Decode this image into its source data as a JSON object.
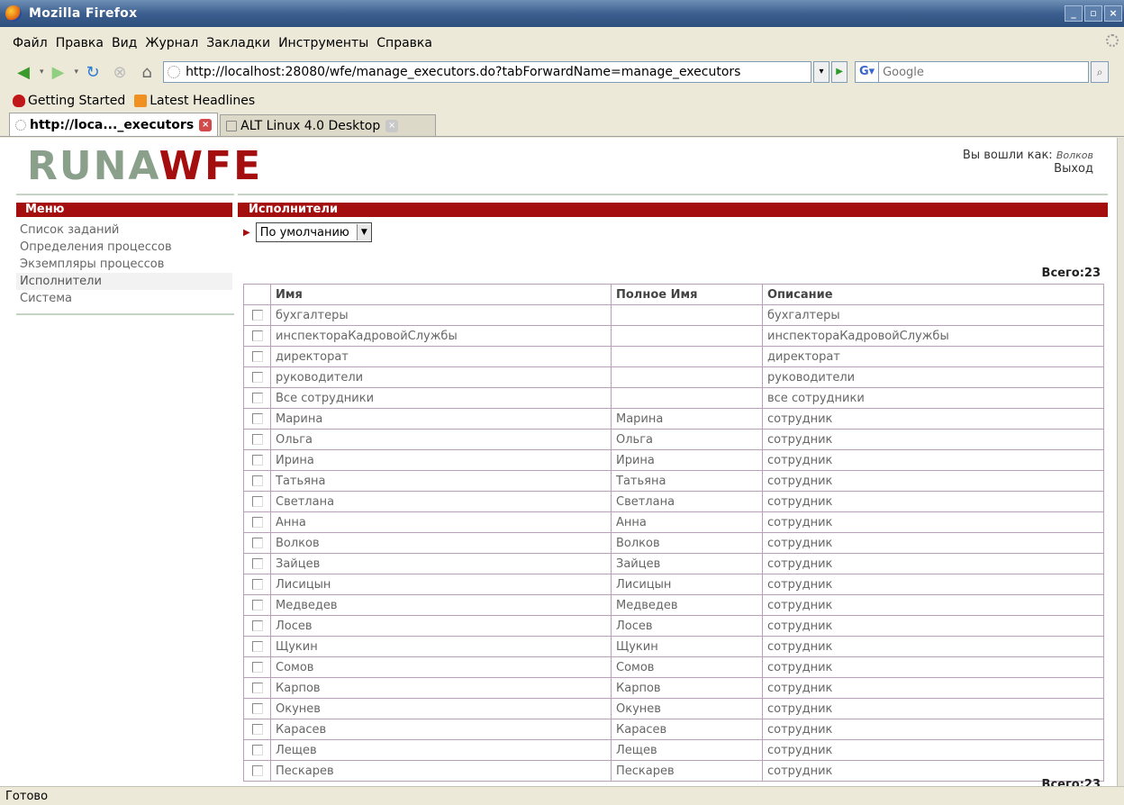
{
  "window": {
    "title": "Mozilla Firefox"
  },
  "menubar": [
    "Файл",
    "Правка",
    "Вид",
    "Журнал",
    "Закладки",
    "Инструменты",
    "Справка"
  ],
  "navbar": {
    "url": "http://localhost:28080/wfe/manage_executors.do?tabForwardName=manage_executors",
    "search_placeholder": "Google"
  },
  "bookmarks": [
    {
      "label": "Getting Started",
      "icon": "getting-started-icon"
    },
    {
      "label": "Latest Headlines",
      "icon": "rss-icon"
    }
  ],
  "tabs": [
    {
      "label": "http://loca..._executors",
      "active": true
    },
    {
      "label": "ALT Linux 4.0 Desktop",
      "active": false
    }
  ],
  "page": {
    "logo_left": "RUNA",
    "logo_right": "WFE",
    "logged_in_label": "Вы вошли как:",
    "username": "Волков",
    "logout": "Выход",
    "menu_title": "Меню",
    "menu_items": [
      {
        "label": "Список заданий",
        "active": false
      },
      {
        "label": "Определения процессов",
        "active": false
      },
      {
        "label": "Экземпляры процессов",
        "active": false
      },
      {
        "label": "Исполнители",
        "active": true
      },
      {
        "label": "Система",
        "active": false
      }
    ],
    "section_title": "Исполнители",
    "filter_value": "По умолчанию",
    "total": "Всего:23",
    "columns": [
      "Имя",
      "Полное Имя",
      "Описание"
    ],
    "rows": [
      {
        "name": "бухгалтеры",
        "full": "",
        "desc": "бухгалтеры"
      },
      {
        "name": "инспектораКадровойСлужбы",
        "full": "",
        "desc": "инспектораКадровойСлужбы"
      },
      {
        "name": "директорат",
        "full": "",
        "desc": "директорат"
      },
      {
        "name": "руководители",
        "full": "",
        "desc": "руководители"
      },
      {
        "name": "Все сотрудники",
        "full": "",
        "desc": "все сотрудники"
      },
      {
        "name": "Марина",
        "full": "Марина",
        "desc": "сотрудник"
      },
      {
        "name": "Ольга",
        "full": "Ольга",
        "desc": "сотрудник"
      },
      {
        "name": "Ирина",
        "full": "Ирина",
        "desc": "сотрудник"
      },
      {
        "name": "Татьяна",
        "full": "Татьяна",
        "desc": "сотрудник"
      },
      {
        "name": "Светлана",
        "full": "Светлана",
        "desc": "сотрудник"
      },
      {
        "name": "Анна",
        "full": "Анна",
        "desc": "сотрудник"
      },
      {
        "name": "Волков",
        "full": "Волков",
        "desc": "сотрудник"
      },
      {
        "name": "Зайцев",
        "full": "Зайцев",
        "desc": "сотрудник"
      },
      {
        "name": "Лисицын",
        "full": "Лисицын",
        "desc": "сотрудник"
      },
      {
        "name": "Медведев",
        "full": "Медведев",
        "desc": "сотрудник"
      },
      {
        "name": "Лосев",
        "full": "Лосев",
        "desc": "сотрудник"
      },
      {
        "name": "Щукин",
        "full": "Щукин",
        "desc": "сотрудник"
      },
      {
        "name": "Сомов",
        "full": "Сомов",
        "desc": "сотрудник"
      },
      {
        "name": "Карпов",
        "full": "Карпов",
        "desc": "сотрудник"
      },
      {
        "name": "Окунев",
        "full": "Окунев",
        "desc": "сотрудник"
      },
      {
        "name": "Карасев",
        "full": "Карасев",
        "desc": "сотрудник"
      },
      {
        "name": "Лещев",
        "full": "Лещев",
        "desc": "сотрудник"
      },
      {
        "name": "Пескарев",
        "full": "Пескарев",
        "desc": "сотрудник"
      }
    ]
  },
  "statusbar": {
    "text": "Готово"
  },
  "colors": {
    "brand_red": "#a50e0e",
    "logo_gray": "#8aa08a"
  }
}
